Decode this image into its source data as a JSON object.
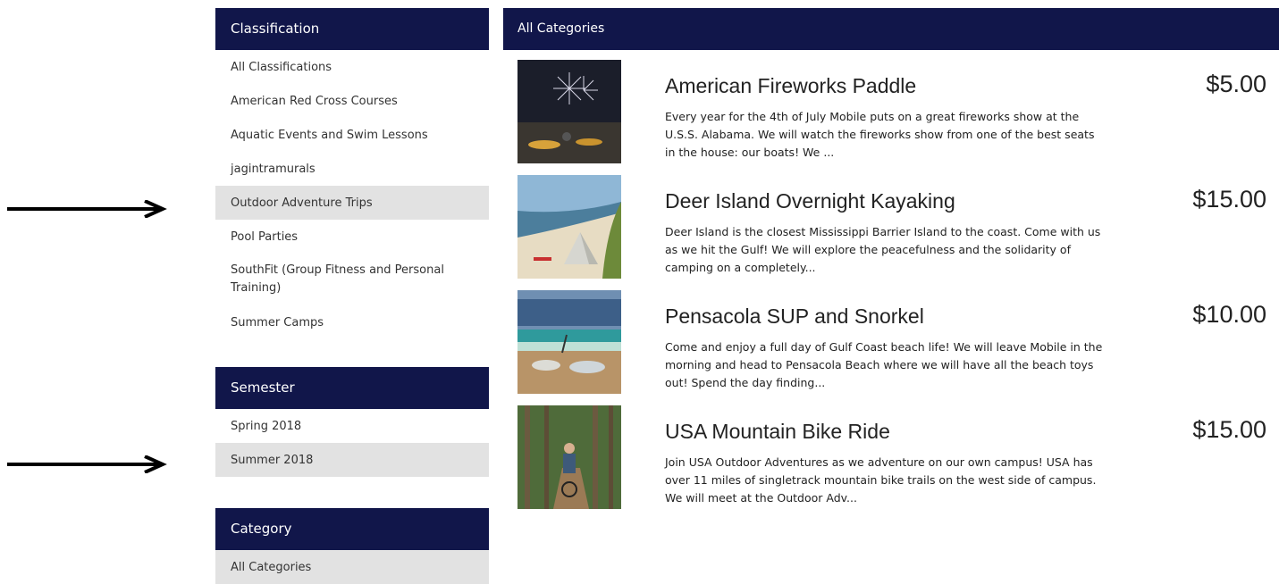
{
  "sidebar": {
    "classification": {
      "title": "Classification",
      "items": [
        {
          "label": "All Classifications"
        },
        {
          "label": "American Red Cross Courses"
        },
        {
          "label": "Aquatic Events and Swim Lessons"
        },
        {
          "label": "jagintramurals"
        },
        {
          "label": "Outdoor Adventure Trips",
          "active": true
        },
        {
          "label": "Pool Parties"
        },
        {
          "label": "SouthFit (Group Fitness and Personal Training)"
        },
        {
          "label": "Summer Camps"
        }
      ]
    },
    "semester": {
      "title": "Semester",
      "items": [
        {
          "label": "Spring 2018"
        },
        {
          "label": "Summer 2018",
          "active": true
        }
      ]
    },
    "category": {
      "title": "Category",
      "items": [
        {
          "label": "All Categories",
          "active": true
        }
      ]
    }
  },
  "main": {
    "header": "All Categories",
    "products": [
      {
        "title": "American Fireworks Paddle",
        "description": "Every year for the 4th of July Mobile puts on a great fireworks show at the U.S.S. Alabama. We will watch the fireworks show from one of the best seats in the house: our boats! We ...",
        "price": "$5.00"
      },
      {
        "title": "Deer Island Overnight Kayaking",
        "description": "Deer Island is the closest Mississippi Barrier Island to the coast. Come with us as we hit the Gulf! We will explore the peacefulness and the solidarity of camping on a completely...",
        "price": "$15.00"
      },
      {
        "title": "Pensacola SUP and Snorkel",
        "description": "Come and enjoy a full day of Gulf Coast beach life! We will leave Mobile in the morning and head to Pensacola Beach where we will have all the beach toys out! Spend the day finding...",
        "price": "$10.00"
      },
      {
        "title": "USA Mountain Bike Ride",
        "description": "Join USA Outdoor Adventures as we adventure on our own campus! USA has over 11 miles of singletrack mountain bike trails on the west side of campus. We will meet at the Outdoor Adv...",
        "price": "$15.00"
      }
    ]
  },
  "colors": {
    "header_bg": "#11164a",
    "active_bg": "#e2e2e2",
    "arrow": "#000000"
  }
}
